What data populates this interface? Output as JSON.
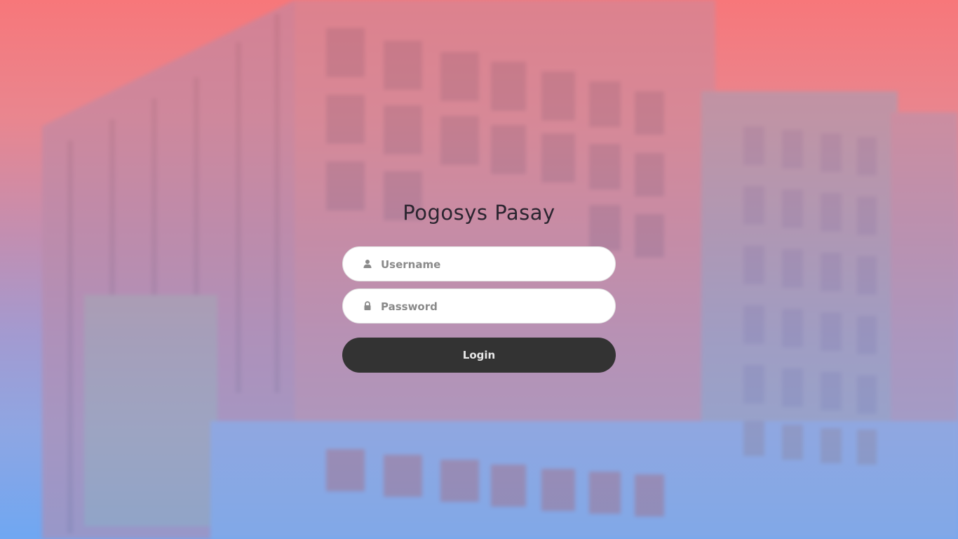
{
  "page": {
    "title": "Pogosys Pasay"
  },
  "form": {
    "username": {
      "placeholder": "Username",
      "value": "",
      "icon": "user-icon"
    },
    "password": {
      "placeholder": "Password",
      "value": "",
      "icon": "lock-icon"
    },
    "login_label": "Login"
  },
  "colors": {
    "gradient_top": "#f7777a",
    "gradient_bottom": "#6fa7f2",
    "button": "#333333",
    "title": "#2b2530"
  }
}
